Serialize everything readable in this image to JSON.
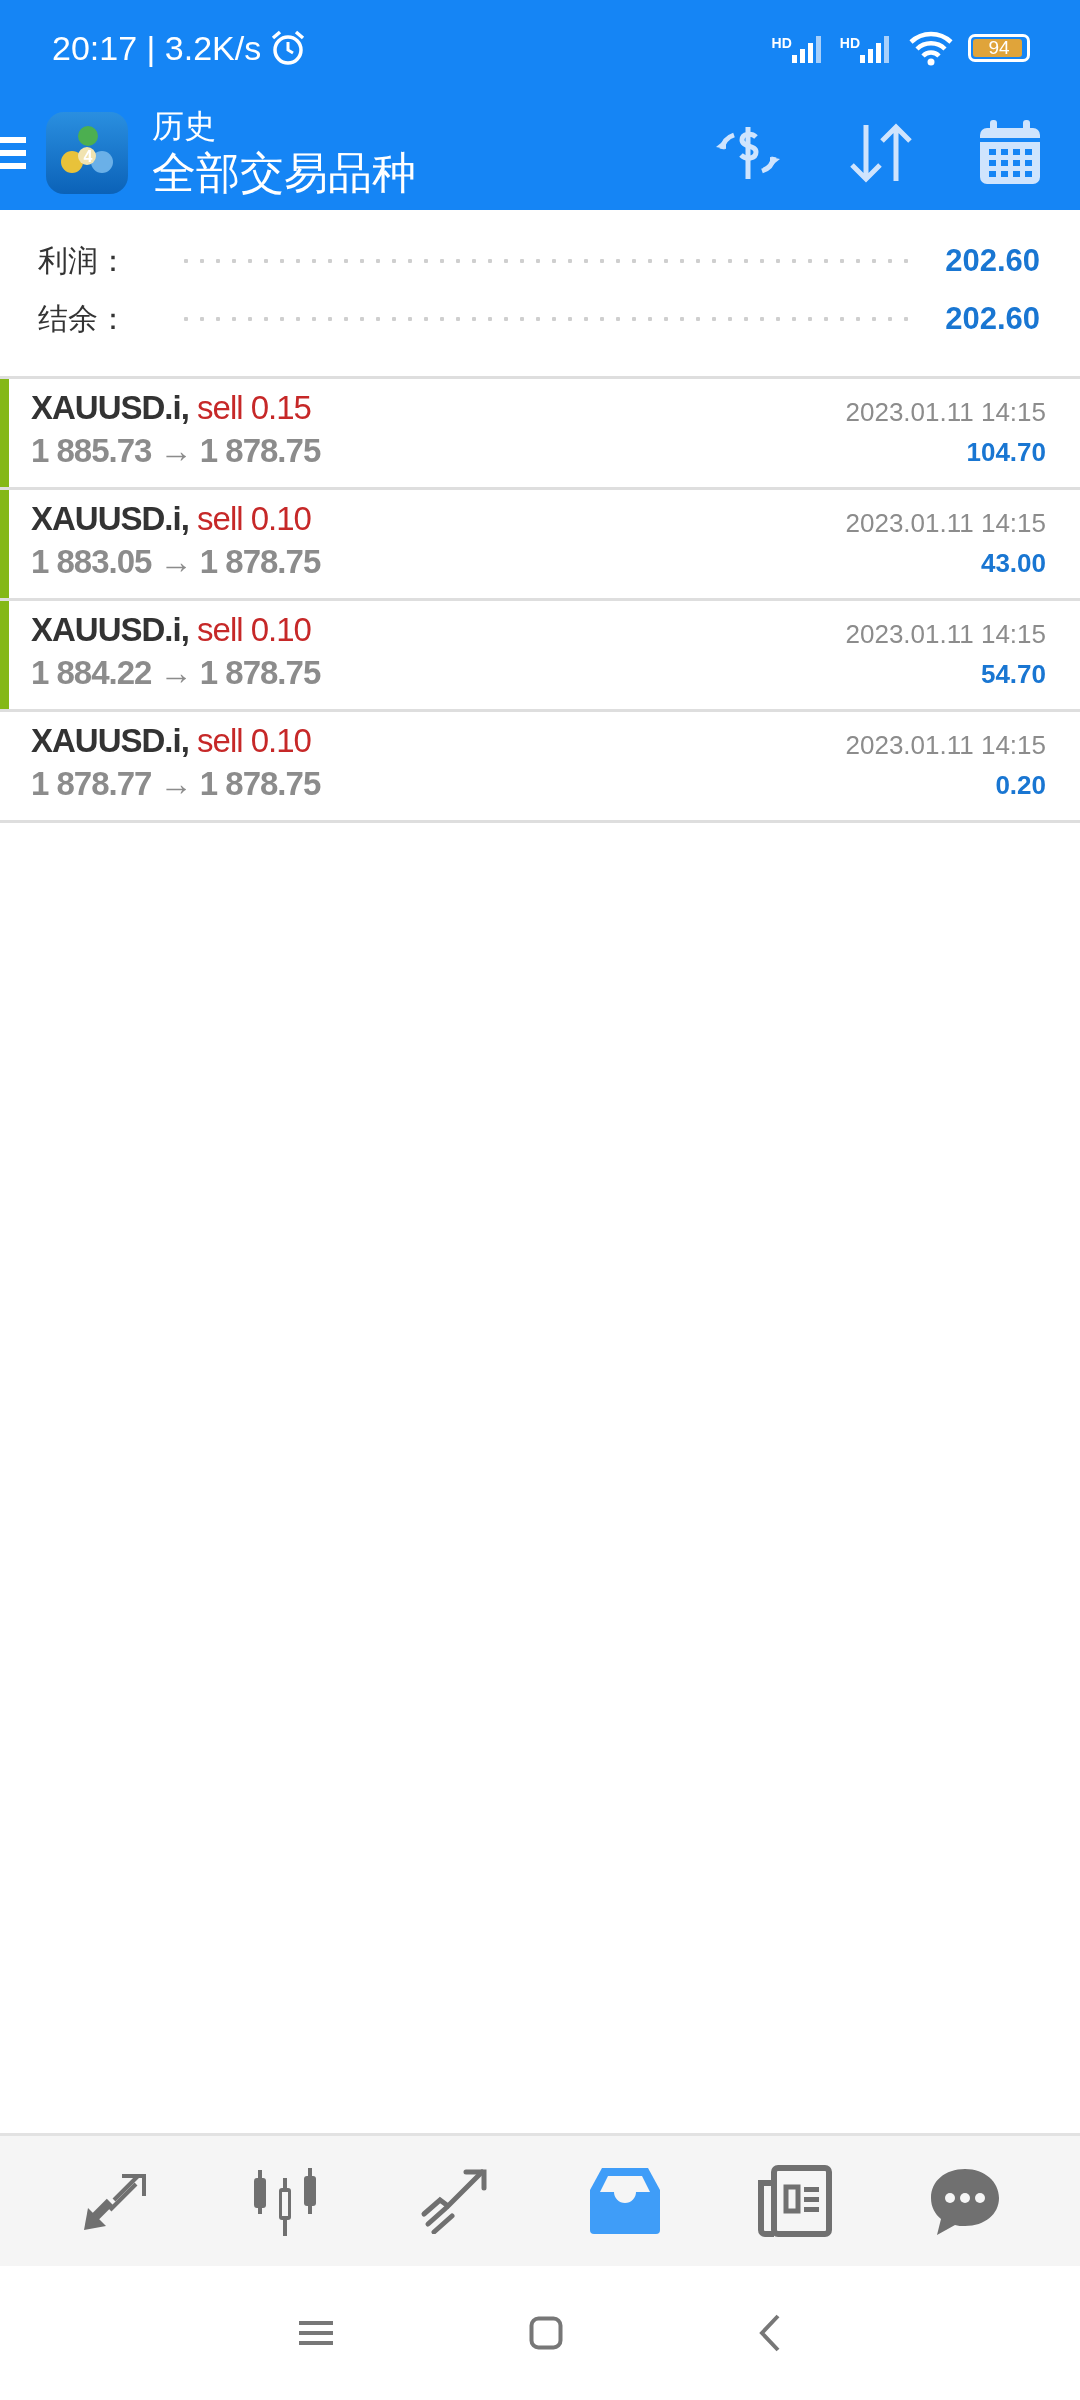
{
  "status_bar": {
    "time": "20:17",
    "speed": "| 3.2K/s",
    "signals": [
      {
        "label": "HD"
      },
      {
        "label": "HD"
      }
    ],
    "battery": "94"
  },
  "header": {
    "logo_badge": "4",
    "title": "历史",
    "subtitle": "全部交易品种"
  },
  "summary": [
    {
      "label": "利润：",
      "value": "202.60"
    },
    {
      "label": "结余：",
      "value": "202.60"
    }
  ],
  "deals": [
    {
      "symbol": "XAUUSD.i,",
      "side": "sell 0.15",
      "prices": "1 885.73 → 1 878.75",
      "time": "2023.01.11 14:15",
      "profit": "104.70",
      "marked": true
    },
    {
      "symbol": "XAUUSD.i,",
      "side": "sell 0.10",
      "prices": "1 883.05 → 1 878.75",
      "time": "2023.01.11 14:15",
      "profit": "43.00",
      "marked": true
    },
    {
      "symbol": "XAUUSD.i,",
      "side": "sell 0.10",
      "prices": "1 884.22 → 1 878.75",
      "time": "2023.01.11 14:15",
      "profit": "54.70",
      "marked": true
    },
    {
      "symbol": "XAUUSD.i,",
      "side": "sell 0.10",
      "prices": "1 878.77 → 1 878.75",
      "time": "2023.01.11 14:15",
      "profit": "0.20",
      "marked": false
    }
  ],
  "bottom_nav": [
    {
      "kind": "trade",
      "selected": false
    },
    {
      "kind": "chart",
      "selected": false
    },
    {
      "kind": "signals",
      "selected": false
    },
    {
      "kind": "history",
      "selected": true
    },
    {
      "kind": "news",
      "selected": false
    },
    {
      "kind": "chat",
      "selected": false
    }
  ]
}
